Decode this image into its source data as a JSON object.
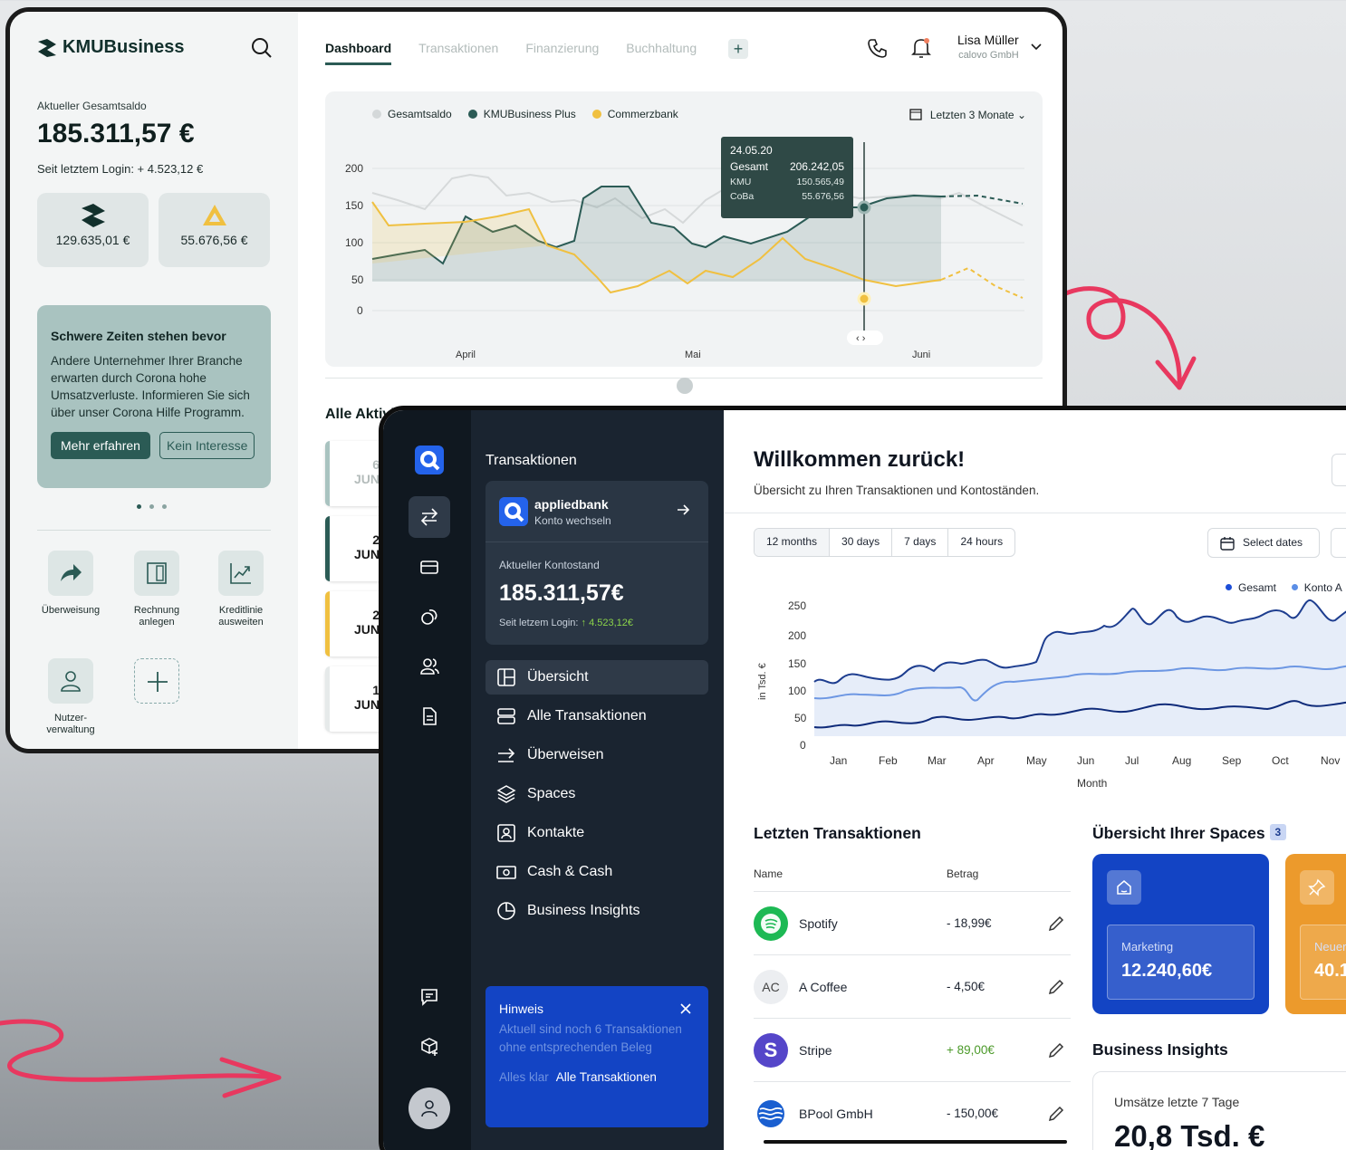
{
  "old_app": {
    "brand": "KMUBusiness",
    "balance_label": "Aktueller Gesamtsaldo",
    "balance": "185.311,57 €",
    "since_login": "Seit letztem Login: + 4.523,12 €",
    "accounts": [
      {
        "name": "KMUBusiness",
        "amount": "129.635,01 €"
      },
      {
        "name": "Commerzbank",
        "amount": "55.676,56 €"
      }
    ],
    "promo": {
      "title": "Schwere Zeiten stehen bevor",
      "text": "Andere Unternehmer Ihrer Branche erwarten durch Corona hohe Umsatzverluste. Informieren Sie sich über unser Corona Hilfe Programm.",
      "primary": "Mehr erfahren",
      "secondary": "Kein Interesse"
    },
    "quick_actions": [
      "Überweisung",
      "Rechnung anlegen",
      "Kreditlinie ausweiten",
      "Nutzer-verwaltung"
    ],
    "tabs": [
      "Dashboard",
      "Transaktionen",
      "Finanzierung",
      "Buchhaltung"
    ],
    "user": {
      "name": "Lisa Müller",
      "company": "calovo GmbH"
    },
    "chart": {
      "legend": [
        "Gesamtsaldo",
        "KMUBusiness Plus",
        "Commerzbank"
      ],
      "period": "Letzten 3 Monate",
      "y_ticks": [
        "200",
        "150",
        "100",
        "50",
        "0"
      ],
      "x_labels": [
        "April",
        "Mai",
        "Juni"
      ],
      "tooltip": {
        "date": "24.05.20",
        "rows": [
          [
            "Gesamt",
            "206.242,05"
          ],
          [
            "KMU",
            "150.565,49"
          ],
          [
            "CoBa",
            "55.676,56"
          ]
        ]
      }
    },
    "activities_title": "Alle Aktivitäten aus allen Konten seit letztem Login",
    "dates": [
      {
        "d": "6",
        "m": "JUN"
      },
      {
        "d": "2",
        "m": "JUN"
      },
      {
        "d": "2",
        "m": "JUN"
      },
      {
        "d": "1",
        "m": "JUN"
      }
    ]
  },
  "new_app": {
    "panel_title": "Transaktionen",
    "bank": {
      "name": "appliedbank",
      "switch": "Konto wechseln",
      "balance_label": "Aktueller Kontostand",
      "balance": "185.311,57€",
      "since_label": "Seit letzem Login:",
      "since_value": "4.523,12€"
    },
    "nav": [
      "Übersicht",
      "Alle Transaktionen",
      "Überweisen",
      "Spaces",
      "Kontakte",
      "Cash & Cash",
      "Business Insights"
    ],
    "hint": {
      "title": "Hinweis",
      "text": "Aktuell sind noch 6 Transaktionen ohne entsprechenden Beleg",
      "dismiss": "Alles klar",
      "link": "Alle Transaktionen"
    },
    "welcome": "Willkommen zurück!",
    "subtitle": "Übersicht zu Ihren Transaktionen und Kontoständen.",
    "ranges": [
      "12 months",
      "30 days",
      "7 days",
      "24 hours"
    ],
    "select_dates": "Select dates",
    "legend": [
      "Gesamt",
      "Konto A"
    ],
    "y_label": "in Tsd. €",
    "x_label": "Month",
    "y_ticks": [
      "250",
      "200",
      "150",
      "100",
      "50",
      "0"
    ],
    "months": [
      "Jan",
      "Feb",
      "Mar",
      "Apr",
      "May",
      "Jun",
      "Jul",
      "Aug",
      "Sep",
      "Oct",
      "Nov"
    ],
    "tx_title": "Letzten Transaktionen",
    "tx_headers": [
      "Name",
      "Betrag"
    ],
    "transactions": [
      {
        "name": "Spotify",
        "amount": "- 18,99€",
        "initials": ""
      },
      {
        "name": "A Coffee",
        "amount": "- 4,50€",
        "initials": "AC"
      },
      {
        "name": "Stripe",
        "amount": "+ 89,00€",
        "initials": "S"
      },
      {
        "name": "BPool GmbH",
        "amount": "- 150,00€",
        "initials": ""
      }
    ],
    "spaces_title": "Übersicht Ihrer Spaces",
    "spaces_count": "3",
    "spaces": [
      {
        "name": "Marketing",
        "amount": "12.240,60€"
      },
      {
        "name": "Neuer",
        "amount": "40.1"
      }
    ],
    "insights_title": "Business Insights",
    "insight": {
      "label": "Umsätze letzte 7 Tage",
      "value": "20,8 Tsd. €"
    }
  },
  "colors": {
    "teal": "#2b5b55",
    "yellow": "#f0c040",
    "blue": "#1344c4",
    "navy": "#101820",
    "orange": "#f0a030",
    "pink": "#e8385f"
  }
}
